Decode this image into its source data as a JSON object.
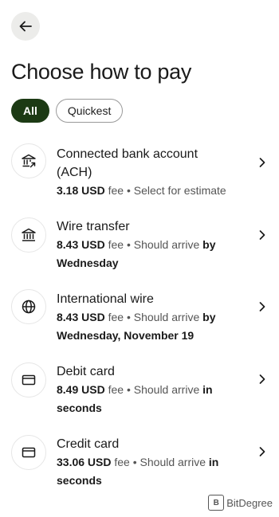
{
  "header": {
    "back_icon": "arrow-left-icon",
    "title": "Choose how to pay"
  },
  "filters": [
    {
      "label": "All",
      "active": true
    },
    {
      "label": "Quickest",
      "active": false
    }
  ],
  "methods": [
    {
      "icon": "bank-transfer-icon",
      "title_line1": "Connected bank account",
      "title_line2": "(ACH)",
      "fee": "3.18 USD",
      "fee_label": "fee",
      "separator": "•",
      "eta_prefix": "Select for estimate",
      "eta_strong_line1": "",
      "eta_line2": ""
    },
    {
      "icon": "bank-icon",
      "title_line1": "Wire transfer",
      "title_line2": "",
      "fee": "8.43 USD",
      "fee_label": "fee",
      "separator": "•",
      "eta_prefix": "Should arrive",
      "eta_strong_line1": "by",
      "eta_line2": "Wednesday"
    },
    {
      "icon": "globe-icon",
      "title_line1": "International wire",
      "title_line2": "",
      "fee": "8.43 USD",
      "fee_label": "fee",
      "separator": "•",
      "eta_prefix": "Should arrive",
      "eta_strong_line1": "by",
      "eta_line2": "Wednesday, November 19"
    },
    {
      "icon": "card-icon",
      "title_line1": "Debit card",
      "title_line2": "",
      "fee": "8.49 USD",
      "fee_label": "fee",
      "separator": "•",
      "eta_prefix": "Should arrive",
      "eta_strong_line1": "in",
      "eta_line2": "seconds"
    },
    {
      "icon": "card-icon",
      "title_line1": "Credit card",
      "title_line2": "",
      "fee": "33.06 USD",
      "fee_label": "fee",
      "separator": "•",
      "eta_prefix": "Should arrive",
      "eta_strong_line1": "in",
      "eta_line2": "seconds"
    }
  ],
  "watermark": {
    "badge": "B",
    "text": "BitDegree"
  },
  "colors": {
    "accent": "#1c3a14",
    "back_button_bg": "#ececea",
    "text_primary": "#1a1a1a",
    "text_secondary": "#555555"
  }
}
